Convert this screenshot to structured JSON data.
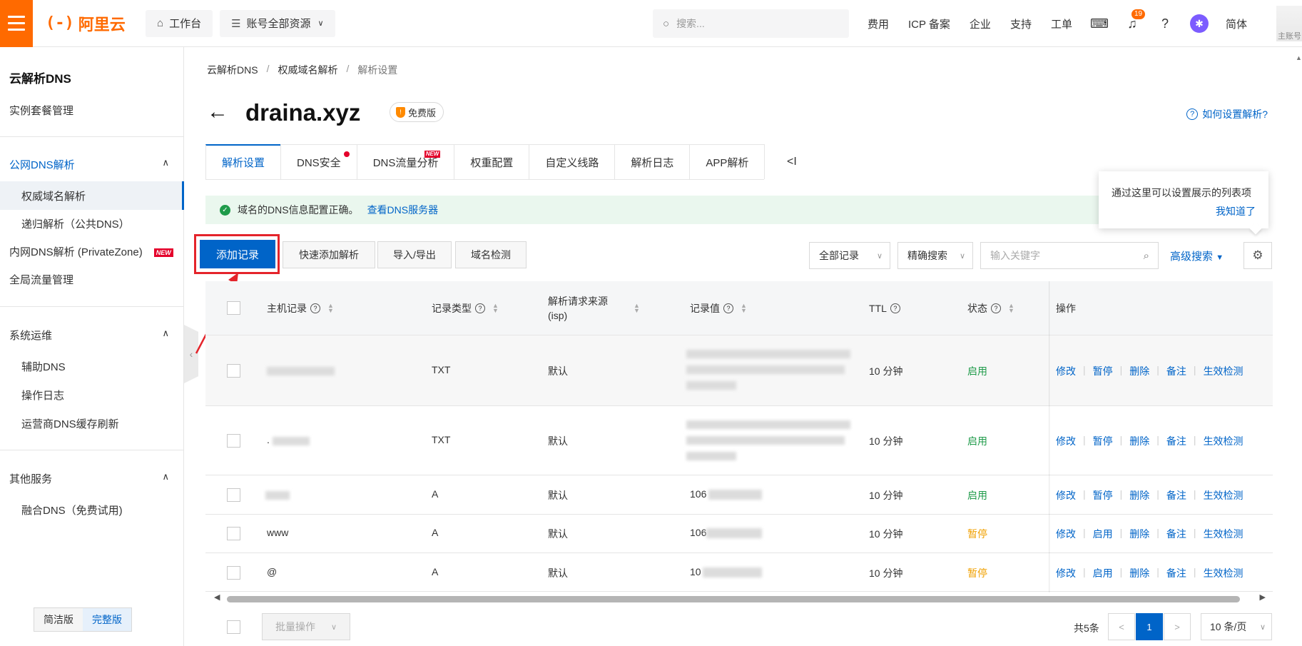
{
  "topbar": {
    "logo_mark": "(-)",
    "logo_text": "阿里云",
    "workbench": "工作台",
    "resources": "账号全部资源",
    "search_placeholder": "搜索...",
    "links": [
      "费用",
      "ICP 备案",
      "企业",
      "支持",
      "工单"
    ],
    "notification_count": "19",
    "language": "简体",
    "account_label": "主账号"
  },
  "sidebar": {
    "title": "云解析DNS",
    "instance": "实例套餐管理",
    "public_dns": "公网DNS解析",
    "authoritative": "权威域名解析",
    "recursive": "递归解析（公共DNS）",
    "private_zone": "内网DNS解析 (PrivateZone)",
    "new_tag": "NEW",
    "global_traffic": "全局流量管理",
    "ops_section": "系统运维",
    "aux_dns": "辅助DNS",
    "op_log": "操作日志",
    "isp_cache": "运营商DNS缓存刷新",
    "other_section": "其他服务",
    "fusion_dns": "融合DNS（免费试用)",
    "mode_simple": "简洁版",
    "mode_full": "完整版"
  },
  "breadcrumb": [
    "云解析DNS",
    "权威域名解析",
    "解析设置"
  ],
  "page": {
    "domain": "draina.xyz",
    "plan": "免费版",
    "help": "如何设置解析?"
  },
  "tabs": [
    {
      "label": "解析设置"
    },
    {
      "label": "DNS安全"
    },
    {
      "label": "DNS流量分析",
      "tag": "NEW"
    },
    {
      "label": "权重配置"
    },
    {
      "label": "自定义线路"
    },
    {
      "label": "解析日志"
    },
    {
      "label": "APP解析"
    }
  ],
  "tabs_more": "<I",
  "alert": {
    "text": "域名的DNS信息配置正确。",
    "link": "查看DNS服务器"
  },
  "tooltip": {
    "text": "通过这里可以设置展示的列表项",
    "ack": "我知道了"
  },
  "toolbar": {
    "add_record": "添加记录",
    "quick_add": "快速添加解析",
    "import_export": "导入/导出",
    "domain_check": "域名检测",
    "filter_all": "全部记录",
    "precise_search": "精确搜索",
    "keyword_placeholder": "输入关键字",
    "advanced_search": "高级搜索"
  },
  "table": {
    "headers": {
      "host": "主机记录",
      "type": "记录类型",
      "source": "解析请求来源(isp)",
      "value": "记录值",
      "ttl": "TTL",
      "status": "状态",
      "ops": "操作"
    },
    "rows": [
      {
        "host": "",
        "type": "TXT",
        "source": "默认",
        "value": "",
        "ttl": "10 分钟",
        "status": "启用",
        "ops": [
          "修改",
          "暂停",
          "删除",
          "备注",
          "生效检测"
        ]
      },
      {
        "host": ".",
        "type": "TXT",
        "source": "默认",
        "value": "",
        "ttl": "10 分钟",
        "status": "启用",
        "ops": [
          "修改",
          "暂停",
          "删除",
          "备注",
          "生效检测"
        ]
      },
      {
        "host": "",
        "type": "A",
        "source": "默认",
        "value": "106",
        "ttl": "10 分钟",
        "status": "启用",
        "ops": [
          "修改",
          "暂停",
          "删除",
          "备注",
          "生效检测"
        ]
      },
      {
        "host": "www",
        "type": "A",
        "source": "默认",
        "value": "106",
        "ttl": "10 分钟",
        "status": "暂停",
        "ops": [
          "修改",
          "启用",
          "删除",
          "备注",
          "生效检测"
        ]
      },
      {
        "host": "@",
        "type": "A",
        "source": "默认",
        "value": "10",
        "ttl": "10 分钟",
        "status": "暂停",
        "ops": [
          "修改",
          "启用",
          "删除",
          "备注",
          "生效检测"
        ]
      }
    ]
  },
  "footer": {
    "batch": "批量操作",
    "total": "共5条",
    "page": "1",
    "page_size": "10 条/页"
  },
  "colors": {
    "brand": "#ff6a00",
    "primary": "#0064c8",
    "enabled": "#1f9b4a",
    "paused": "#f0a000",
    "annotation": "#e4242b"
  }
}
